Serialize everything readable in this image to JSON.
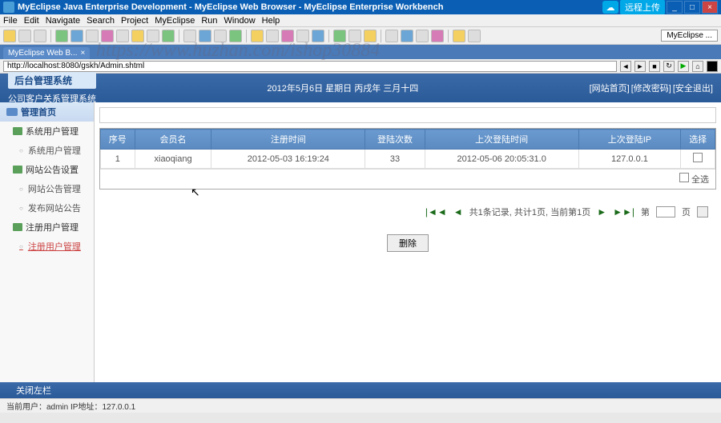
{
  "window": {
    "title": "MyEclipse Java Enterprise Development - MyEclipse Web Browser - MyEclipse Enterprise Workbench",
    "upload_label": "远程上传"
  },
  "menu": [
    "File",
    "Edit",
    "Navigate",
    "Search",
    "Project",
    "MyEclipse",
    "Run",
    "Window",
    "Help"
  ],
  "myeclipse_button": "MyEclipse ...",
  "tab": {
    "label": "MyEclipse Web B..."
  },
  "watermark": "https://www.huzhan.com/ishop30884",
  "address": "http://localhost:8080/gskh/Admin.shtml",
  "header": {
    "logo": "后台管理系统",
    "subtitle": "公司客户关系管理系统",
    "date": "2012年5月6日  星期日  丙戌年  三月十四",
    "links": [
      "[网站首页]",
      "[修改密码]",
      "[安全退出]"
    ]
  },
  "sidebar": {
    "group": "管理首页",
    "items": [
      {
        "label": "系统用户管理",
        "type": "leaf"
      },
      {
        "label": "系统用户管理",
        "type": "sub"
      },
      {
        "label": "网站公告设置",
        "type": "leaf"
      },
      {
        "label": "网站公告管理",
        "type": "sub"
      },
      {
        "label": "发布网站公告",
        "type": "sub"
      },
      {
        "label": "注册用户管理",
        "type": "leaf"
      },
      {
        "label": "注册用户管理",
        "type": "sub",
        "active": true
      }
    ]
  },
  "table": {
    "headers": [
      "序号",
      "会员名",
      "注册时间",
      "登陆次数",
      "上次登陆时间",
      "上次登陆IP",
      "选择"
    ],
    "rows": [
      {
        "seq": "1",
        "name": "xiaoqiang",
        "reg": "2012-05-03 16:19:24",
        "count": "33",
        "last": "2012-05-06 20:05:31.0",
        "ip": "127.0.0.1"
      }
    ],
    "select_all": "全选"
  },
  "pagination": {
    "info": "共1条记录, 共计1页, 当前第1页",
    "page_label_prefix": "第",
    "page_label_suffix": "页",
    "page_value": ""
  },
  "delete_label": "删除",
  "footer_collapse": "关闭左栏",
  "status": "当前用户：admin   IP地址：127.0.0.1"
}
